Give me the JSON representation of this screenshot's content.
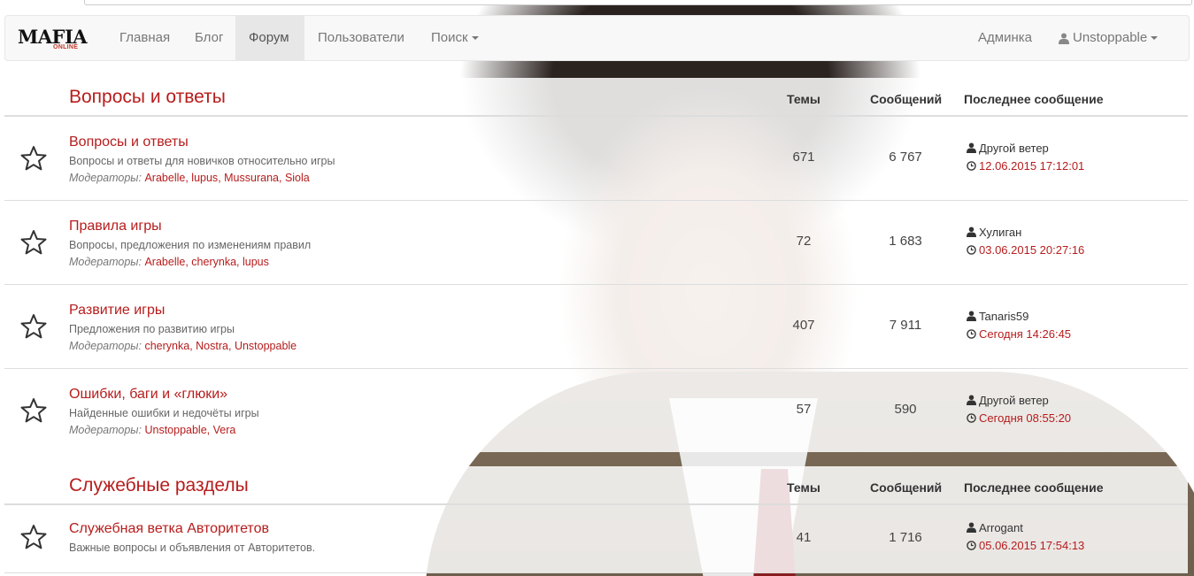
{
  "navbar": {
    "brand_main": "MAFIA",
    "brand_sub": "ONLINE",
    "items": [
      {
        "label": "Главная"
      },
      {
        "label": "Блог"
      },
      {
        "label": "Форум"
      },
      {
        "label": "Пользователи"
      },
      {
        "label": "Поиск"
      }
    ],
    "admin_label": "Админка",
    "user_label": "Unstoppable"
  },
  "columns": {
    "topics": "Темы",
    "messages": "Сообщений",
    "last": "Последнее сообщение"
  },
  "moderators_label": "Модераторы:",
  "categories": [
    {
      "title": "Вопросы и ответы",
      "forums": [
        {
          "title": "Вопросы и ответы",
          "desc": "Вопросы и ответы для новичков относительно игры",
          "mods": [
            "Arabelle",
            "lupus",
            "Mussurana",
            "Siola"
          ],
          "topics": "671",
          "messages": "6 767",
          "last_user": "Другой ветер",
          "last_time": "12.06.2015 17:12:01"
        },
        {
          "title": "Правила игры",
          "desc": "Вопросы, предложения по изменениям правил",
          "mods": [
            "Arabelle",
            "cherynka",
            "lupus"
          ],
          "topics": "72",
          "messages": "1 683",
          "last_user": "Хулиган",
          "last_time": "03.06.2015 20:27:16"
        },
        {
          "title": "Развитие игры",
          "desc": "Предложения по развитию игры",
          "mods": [
            "cherynka",
            "Nostra",
            "Unstoppable"
          ],
          "topics": "407",
          "messages": "7 911",
          "last_user": "Tanaris59",
          "last_time": "Сегодня 14:26:45"
        },
        {
          "title": "Ошибки, баги и «глюки»",
          "desc": "Найденные ошибки и недочёты игры",
          "mods": [
            "Unstoppable",
            "Vera"
          ],
          "topics": "57",
          "messages": "590",
          "last_user": "Другой ветер",
          "last_time": "Сегодня 08:55:20"
        }
      ]
    },
    {
      "title": "Служебные разделы",
      "forums": [
        {
          "title": "Служебная ветка Авторитетов",
          "desc": "Важные вопросы и объявления от Авторитетов.",
          "mods": [],
          "topics": "41",
          "messages": "1 716",
          "last_user": "Arrogant",
          "last_time": "05.06.2015 17:54:13"
        }
      ]
    }
  ]
}
